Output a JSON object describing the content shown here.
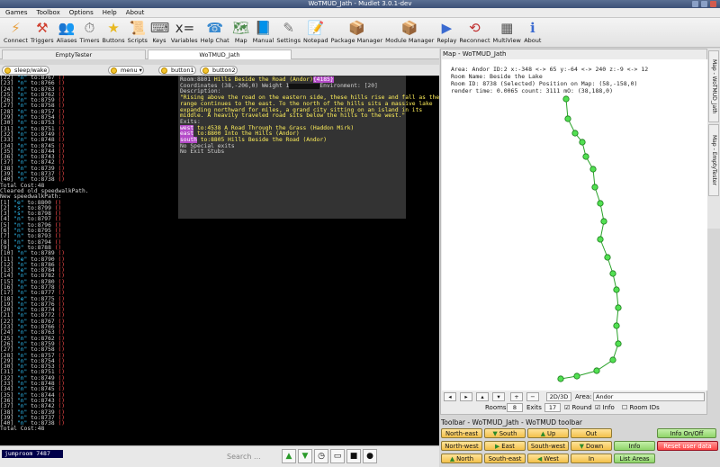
{
  "window": {
    "title": "WoTMUD_Jath - Mudlet 3.0.1-dev"
  },
  "menu": [
    "Games",
    "Toolbox",
    "Options",
    "Help",
    "About"
  ],
  "toolbar": [
    {
      "label": "Connect",
      "icon": "connect-icon",
      "glyph": "⚡",
      "color": "#e8a040"
    },
    {
      "label": "Triggers",
      "icon": "triggers-icon",
      "glyph": "⚒",
      "color": "#d04030"
    },
    {
      "label": "Aliases",
      "icon": "aliases-icon",
      "glyph": "👥",
      "color": "#6c8cc0"
    },
    {
      "label": "Timers",
      "icon": "timers-icon",
      "glyph": "⏱",
      "color": "#666"
    },
    {
      "label": "Buttons",
      "icon": "buttons-icon",
      "glyph": "★",
      "color": "#e8b820"
    },
    {
      "label": "Scripts",
      "icon": "scripts-icon",
      "glyph": "📜",
      "color": "#9a7b40"
    },
    {
      "label": "Keys",
      "icon": "keys-icon",
      "glyph": "⌨",
      "color": "#555"
    },
    {
      "label": "Variables",
      "icon": "variables-icon",
      "glyph": "x=",
      "color": "#333"
    },
    {
      "label": "Help Chat",
      "icon": "help-chat-icon",
      "glyph": "☎",
      "color": "#3a8ad0"
    },
    {
      "label": "Map",
      "icon": "map-icon",
      "glyph": "🗺",
      "color": "#4a8a4a"
    },
    {
      "label": "Manual",
      "icon": "manual-icon",
      "glyph": "📘",
      "color": "#2a5ab0"
    },
    {
      "label": "Settings",
      "icon": "settings-icon",
      "glyph": "✎",
      "color": "#777"
    },
    {
      "label": "Notepad",
      "icon": "notepad-icon",
      "glyph": "📝",
      "color": "#888"
    },
    {
      "label": "Package Manager",
      "icon": "package-manager-icon",
      "glyph": "📦",
      "color": "#a07040"
    },
    {
      "label": "Module Manager",
      "icon": "module-manager-icon",
      "glyph": "📦",
      "color": "#a07040"
    },
    {
      "label": "Replay",
      "icon": "replay-icon",
      "glyph": "▶",
      "color": "#3a6ad0"
    },
    {
      "label": "Reconnect",
      "icon": "reconnect-icon",
      "glyph": "⟲",
      "color": "#c03030"
    },
    {
      "label": "MultiView",
      "icon": "multiview-icon",
      "glyph": "▦",
      "color": "#555"
    },
    {
      "label": "About",
      "icon": "about-icon",
      "glyph": "ℹ",
      "color": "#3a6ad0"
    }
  ],
  "profile_tabs": [
    "EmptyTester",
    "WoTMUD_Jath"
  ],
  "buttons": {
    "sleep": "sleep/wake",
    "menu": "menu ▾",
    "b1": "button1",
    "b2": "button2"
  },
  "console_lines": [
    [
      "[22]",
      "\"n\"",
      "to:8767",
      "()"
    ],
    [
      "[23]",
      "\"n\"",
      "to:8766",
      "()"
    ],
    [
      "[24]",
      "\"n\"",
      "to:8763",
      "()"
    ],
    [
      "[25]",
      "\"n\"",
      "to:8762",
      "()"
    ],
    [
      "[26]",
      "\"n\"",
      "to:8759",
      "()"
    ],
    [
      "[27]",
      "\"n\"",
      "to:8758",
      "()"
    ],
    [
      "[28]",
      "\"n\"",
      "to:8757",
      "()"
    ],
    [
      "[29]",
      "\"n\"",
      "to:8754",
      "()"
    ],
    [
      "[30]",
      "\"n\"",
      "to:8753",
      "()"
    ],
    [
      "[31]",
      "\"n\"",
      "to:8751",
      "()"
    ],
    [
      "[32]",
      "\"n\"",
      "to:8749",
      "()"
    ],
    [
      "[33]",
      "\"n\"",
      "to:8748",
      "()"
    ],
    [
      "[34]",
      "\"n\"",
      "to:8745",
      "()"
    ],
    [
      "[35]",
      "\"n\"",
      "to:8744",
      "()"
    ],
    [
      "[36]",
      "\"n\"",
      "to:8743",
      "()"
    ],
    [
      "[37]",
      "\"n\"",
      "to:8742",
      "()"
    ],
    [
      "[38]",
      "\"n\"",
      "to:8739",
      "()"
    ],
    [
      "[39]",
      "\"n\"",
      "to:8737",
      "()"
    ],
    [
      "[40]",
      "\"n\"",
      "to:8738",
      "()"
    ],
    [
      "Total Cost:48"
    ],
    [
      "Cleared old speedwalkPath."
    ],
    [
      "New speedwalkPath:"
    ],
    [
      "[1]",
      "\"e\"",
      "to:8800",
      "()"
    ],
    [
      "[2]",
      "\"s\"",
      "to:8799",
      "()"
    ],
    [
      "[3]",
      "\"s\"",
      "to:8798",
      "()"
    ],
    [
      "[4]",
      "\"n\"",
      "to:8797",
      "()"
    ],
    [
      "[5]",
      "\"n\"",
      "to:8796",
      "()"
    ],
    [
      "[6]",
      "\"n\"",
      "to:8795",
      "()"
    ],
    [
      "[7]",
      "\"n\"",
      "to:8793",
      "()"
    ],
    [
      "[8]",
      "\"n\"",
      "to:8794",
      "()"
    ],
    [
      "[9]",
      "\"e\"",
      "to:8788",
      "()"
    ],
    [
      "[10]",
      "\"n\"",
      "to:8789",
      "()"
    ],
    [
      "[11]",
      "\"e\"",
      "to:8790",
      "()"
    ],
    [
      "[12]",
      "\"n\"",
      "to:8786",
      "()"
    ],
    [
      "[13]",
      "\"e\"",
      "to:8784",
      "()"
    ],
    [
      "[14]",
      "\"n\"",
      "to:8782",
      "()"
    ],
    [
      "[15]",
      "\"n\"",
      "to:8780",
      "()"
    ],
    [
      "[16]",
      "\"n\"",
      "to:8778",
      "()"
    ],
    [
      "[17]",
      "\"n\"",
      "to:8777",
      "()"
    ],
    [
      "[18]",
      "\"e\"",
      "to:8775",
      "()"
    ],
    [
      "[19]",
      "\"n\"",
      "to:8776",
      "()"
    ],
    [
      "[20]",
      "\"n\"",
      "to:8774",
      "()"
    ],
    [
      "[21]",
      "\"n\"",
      "to:8772",
      "()"
    ],
    [
      "[22]",
      "\"n\"",
      "to:8767",
      "()"
    ],
    [
      "[23]",
      "\"n\"",
      "to:8766",
      "()"
    ],
    [
      "[24]",
      "\"n\"",
      "to:8763",
      "()"
    ],
    [
      "[25]",
      "\"n\"",
      "to:8762",
      "()"
    ],
    [
      "[26]",
      "\"n\"",
      "to:8759",
      "()"
    ],
    [
      "[27]",
      "\"n\"",
      "to:8758",
      "()"
    ],
    [
      "[28]",
      "\"n\"",
      "to:8757",
      "()"
    ],
    [
      "[29]",
      "\"n\"",
      "to:8754",
      "()"
    ],
    [
      "[30]",
      "\"n\"",
      "to:8753",
      "()"
    ],
    [
      "[31]",
      "\"n\"",
      "to:8751",
      "()"
    ],
    [
      "[32]",
      "\"n\"",
      "to:8749",
      "()"
    ],
    [
      "[33]",
      "\"n\"",
      "to:8748",
      "()"
    ],
    [
      "[34]",
      "\"n\"",
      "to:8745",
      "()"
    ],
    [
      "[35]",
      "\"n\"",
      "to:8744",
      "()"
    ],
    [
      "[36]",
      "\"n\"",
      "to:8743",
      "()"
    ],
    [
      "[37]",
      "\"n\"",
      "to:8742",
      "()"
    ],
    [
      "[38]",
      "\"n\"",
      "to:8739",
      "()"
    ],
    [
      "[39]",
      "\"n\"",
      "to:8737",
      "()"
    ],
    [
      "[40]",
      "\"n\"",
      "to:8738",
      "()"
    ],
    [
      "Total Cost:48"
    ]
  ],
  "room": {
    "line1_prefix": "Room:8801 ",
    "line1_name": "Hills Beside the Road (Andor)",
    "line1_id": "{4185}",
    "coords": "Coordinates (38,-206,0) Weight 1",
    "env": "Environment: [20]",
    "desc_label": "Description:",
    "desc": [
      "\"Rising above the road on the eastern side, these hills rise and fall as the",
      "range continues to the east. To the north of the hills sits a massive lake",
      "expanding northward for miles, a grand city sitting on an island in its",
      "middle. A heavily traveled road sits below the hills to the west.\""
    ],
    "exits_label": "Exits:",
    "exits": [
      {
        "dir": "west",
        "rest": " to:4538 A Road Through the Grass (Haddon Mirk)"
      },
      {
        "dir": "east",
        "rest": " to:8800 Into the Hills (Andor)"
      },
      {
        "dir": "south",
        "rest": " to:8805 Hills Beside the Road (Andor)"
      }
    ],
    "special": "No Special exits",
    "stubs": "No Exit Stubs"
  },
  "command_line": {
    "value": "jumproom 7487",
    "search": "Search ..."
  },
  "map": {
    "title": "Map - WoTMUD_Jath",
    "info": [
      "Area: Andor ID:2 x:-348 <-> 65 y:-64 <-> 240 z:-9 <-> 12",
      "Room Name: Beside the Lake",
      "Room ID: 8738 (Selected) Position on Map: (58,-158,0)",
      "render time: 0.0065 count: 3111 mO: (38,188,0)"
    ],
    "controls": {
      "view": "2D/3D",
      "area_label": "Area:",
      "area": "Andor",
      "rooms_label": "Rooms",
      "rooms": "8",
      "exits_label": "Exits",
      "exits": "17",
      "round": "Round",
      "info": "Info",
      "roomids": "Room IDs"
    }
  },
  "side_tabs": [
    "Map - WoTMUD_Jath",
    "Map - EmptyTester"
  ],
  "wot_toolbar": {
    "title": "Toolbar - WoTMUD_Jath - WoTMUD toolbar",
    "rows": [
      [
        {
          "label": "North-east"
        },
        {
          "label": "South",
          "arrow": "down"
        },
        {
          "label": "Up",
          "arrow": "up"
        },
        {
          "label": "Out"
        },
        {
          "label": "Info On/Off",
          "kind": "grn"
        }
      ],
      [
        {
          "label": "North-west"
        },
        {
          "label": "East",
          "arrow": "right"
        },
        {
          "label": "South-west"
        },
        {
          "label": "Down",
          "arrow": "down"
        },
        {
          "label": "Info",
          "kind": "grn"
        },
        {
          "label": "Reset user data",
          "kind": "red"
        }
      ],
      [
        {
          "label": "North",
          "arrow": "up"
        },
        {
          "label": "South-east"
        },
        {
          "label": "West",
          "arrow": "left"
        },
        {
          "label": "In"
        },
        {
          "label": "List Areas",
          "kind": "grn"
        }
      ]
    ]
  }
}
